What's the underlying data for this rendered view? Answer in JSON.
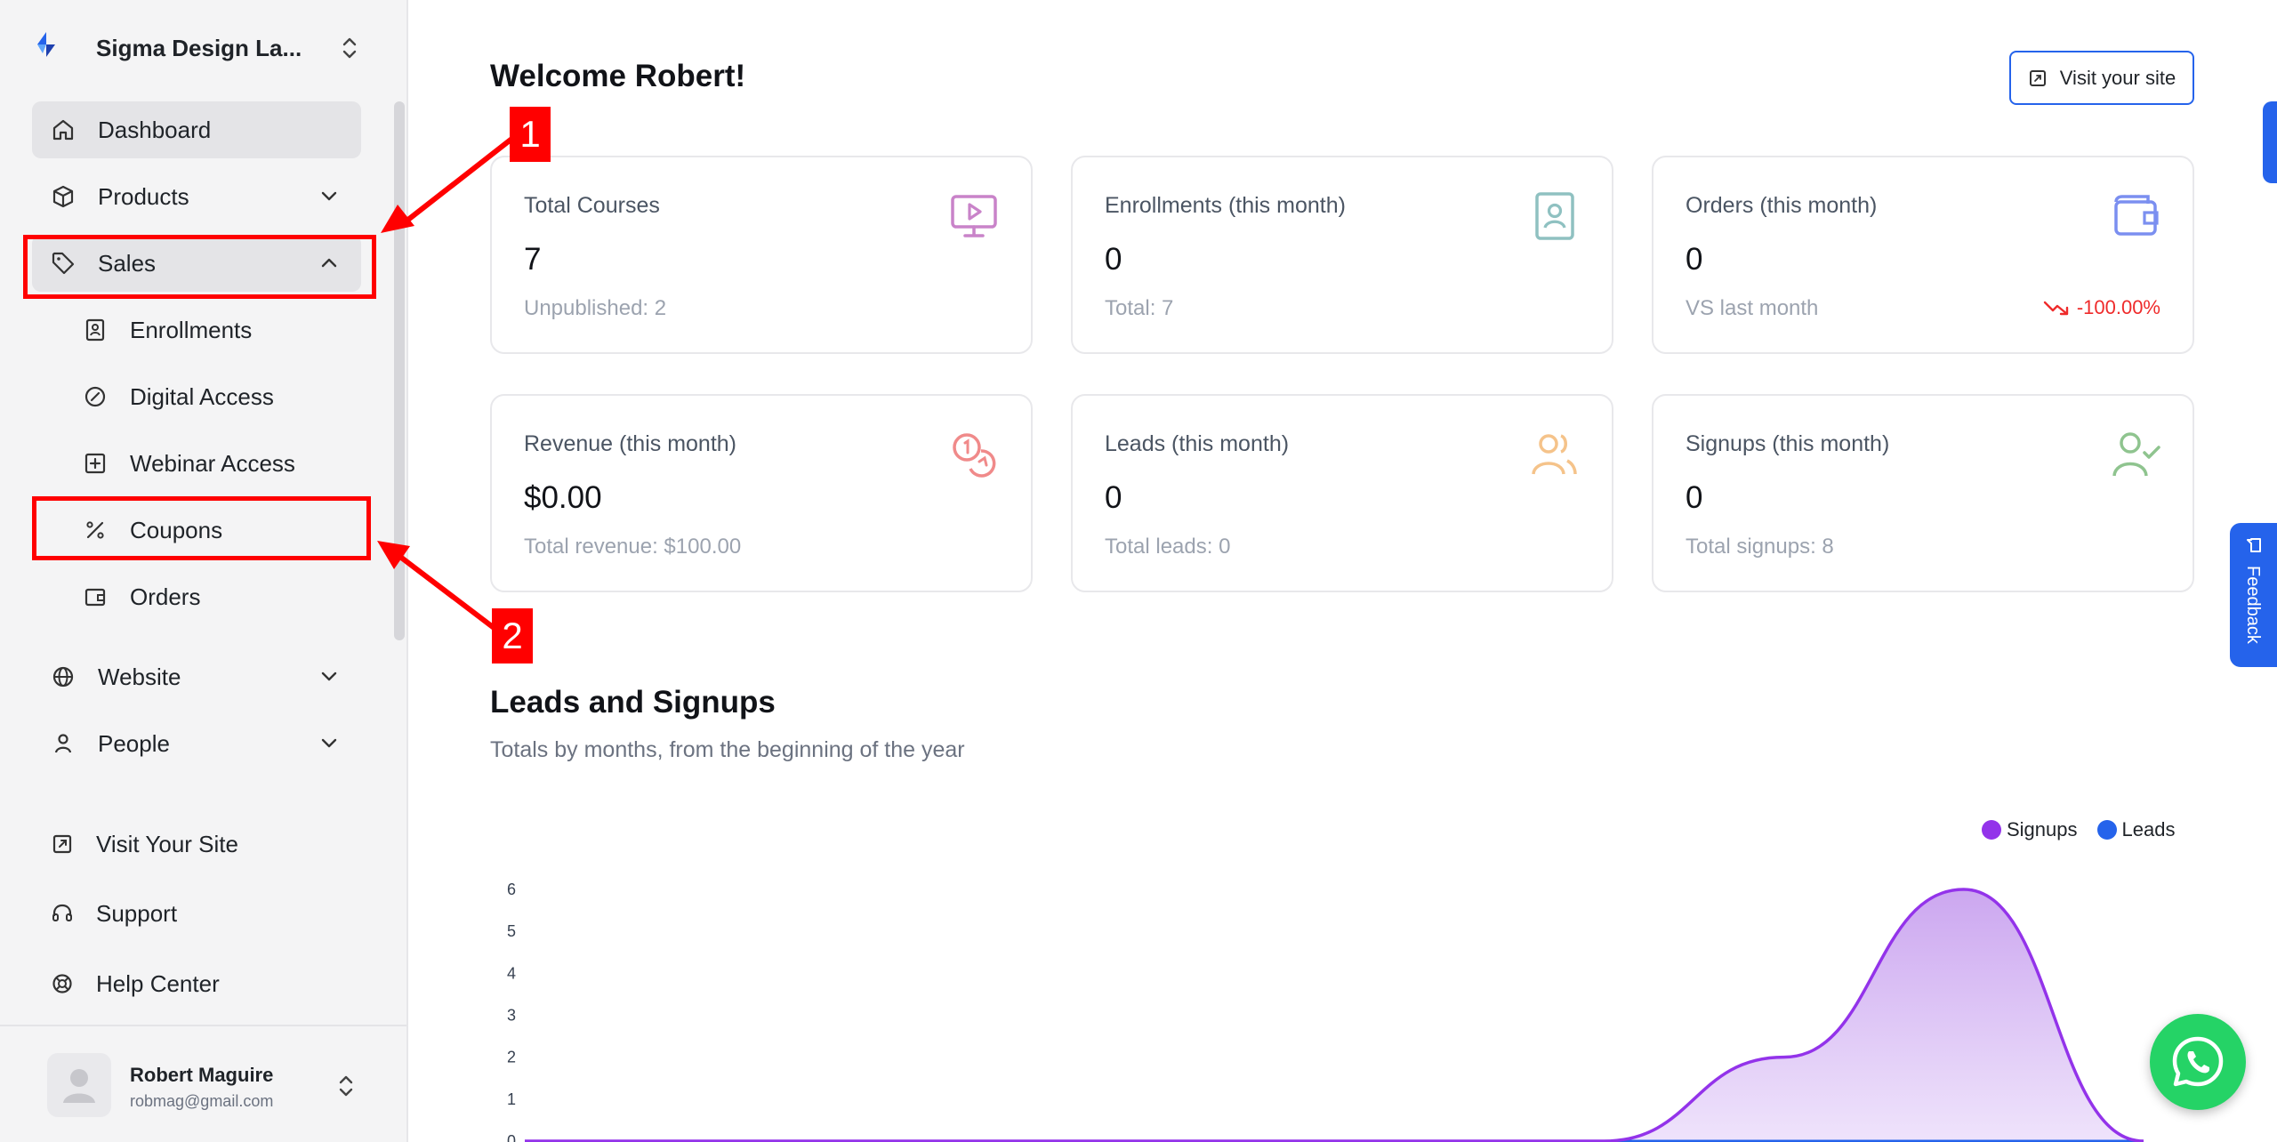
{
  "brand": {
    "name": "Sigma Design La..."
  },
  "nav": {
    "dashboard": "Dashboard",
    "products": "Products",
    "sales": "Sales",
    "sales_items": [
      "Enrollments",
      "Digital Access",
      "Webinar Access",
      "Coupons",
      "Orders"
    ],
    "website": "Website",
    "people": "People"
  },
  "footer_nav": [
    "Visit Your Site",
    "Support",
    "Help Center"
  ],
  "user": {
    "name": "Robert Maguire",
    "email": "robmag@gmail.com"
  },
  "header": {
    "welcome": "Welcome Robert!",
    "visit_button": "Visit your site"
  },
  "cards": [
    {
      "title": "Total Courses",
      "value": "7",
      "sub": "Unpublished: 2",
      "icon": "monitor-play-icon",
      "color": "#c983c9"
    },
    {
      "title": "Enrollments (this month)",
      "value": "0",
      "sub": "Total: 7",
      "icon": "contact-book-icon",
      "color": "#8fc1c1"
    },
    {
      "title": "Orders (this month)",
      "value": "0",
      "sub": "VS last month",
      "trend": "-100.00%",
      "icon": "wallet-icon",
      "color": "#7b8ff0"
    },
    {
      "title": "Revenue (this month)",
      "value": "$0.00",
      "sub": "Total revenue: $100.00",
      "icon": "coins-icon",
      "color": "#f08a8a"
    },
    {
      "title": "Leads (this month)",
      "value": "0",
      "sub": "Total leads: 0",
      "icon": "users-icon",
      "color": "#f5c38a"
    },
    {
      "title": "Signups (this month)",
      "value": "0",
      "sub": "Total signups: 8",
      "icon": "user-check-icon",
      "color": "#8fc48f"
    }
  ],
  "section": {
    "title": "Leads and Signups",
    "subtitle": "Totals by months, from the beginning of the year"
  },
  "feedback": "Feedback",
  "annotations": [
    "1",
    "2"
  ],
  "colors": {
    "accent": "#2563eb",
    "signups": "#9333ea",
    "leads": "#2563eb",
    "annotation": "#ff0000"
  },
  "chart_data": {
    "type": "area",
    "yticks": [
      "6",
      "5",
      "4",
      "3",
      "2",
      "1",
      "0"
    ],
    "ylim": [
      0,
      6
    ],
    "grid": false,
    "legend_position": "top-right",
    "series": [
      {
        "name": "Signups",
        "color": "#9333ea",
        "points": [
          [
            0,
            0
          ],
          [
            1,
            0
          ],
          [
            2,
            0
          ],
          [
            3,
            0
          ],
          [
            4,
            0
          ],
          [
            5,
            0
          ],
          [
            6,
            0
          ],
          [
            7,
            2
          ],
          [
            8,
            6
          ],
          [
            9,
            0
          ]
        ]
      },
      {
        "name": "Leads",
        "color": "#2563eb",
        "points": [
          [
            0,
            0
          ],
          [
            1,
            0
          ],
          [
            2,
            0
          ],
          [
            3,
            0
          ],
          [
            4,
            0
          ],
          [
            5,
            0
          ],
          [
            6,
            0
          ],
          [
            7,
            0
          ],
          [
            8,
            0
          ],
          [
            9,
            0
          ]
        ]
      }
    ]
  }
}
